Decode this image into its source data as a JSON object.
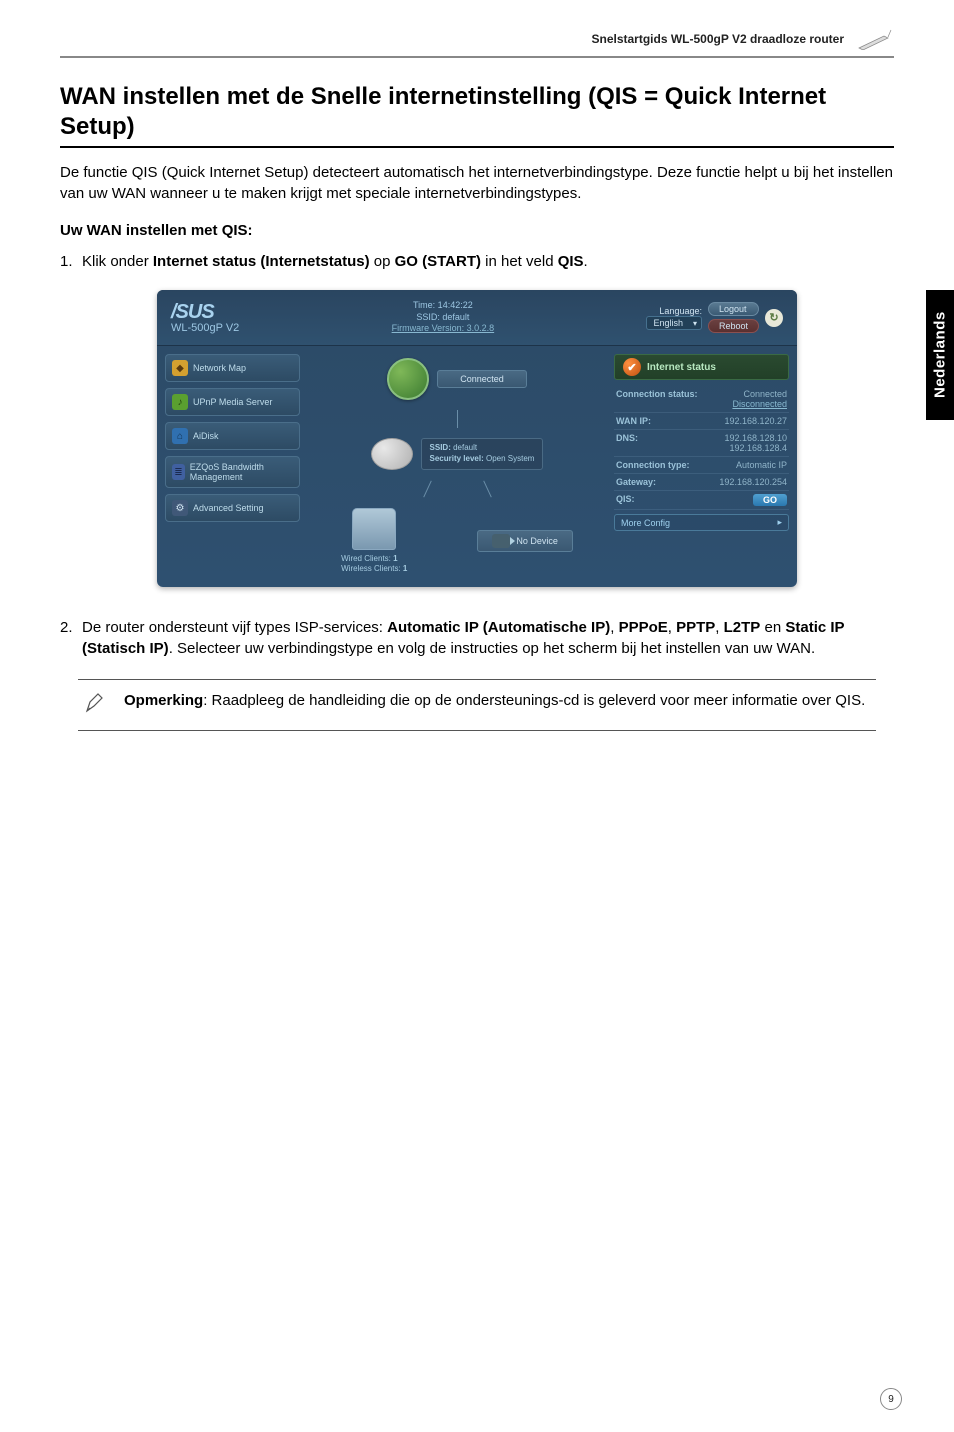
{
  "header": {
    "doc_title": "Snelstartgids WL-500gP V2 draadloze router"
  },
  "side_tab": "Nederlands",
  "section": {
    "title": "WAN instellen met de Snelle internetinstelling (QIS = Quick Internet Setup)",
    "intro": "De functie QIS (Quick Internet Setup) detecteert automatisch het internetverbindingstype. Deze functie helpt u bij het instellen van uw WAN wanneer u te maken krijgt met speciale internetverbindingstypes.",
    "subhead": "Uw WAN instellen met QIS:",
    "step1_pre": "Klik onder ",
    "step1_b1": "Internet status (Internetstatus)",
    "step1_mid": " op ",
    "step1_b2": "GO (START)",
    "step1_mid2": " in het veld ",
    "step1_b3": "QIS",
    "step1_end": ".",
    "step2_pre": "De router ondersteunt vijf types ISP-services: ",
    "step2_b1": "Automatic IP (Automatische IP)",
    "step2_c1": ", ",
    "step2_b2": "PPPoE",
    "step2_c2": ", ",
    "step2_b3": "PPTP",
    "step2_c3": ", ",
    "step2_b4": "L2TP",
    "step2_c4": " en ",
    "step2_b5": "Static IP (Statisch IP)",
    "step2_end": ". Selecteer uw verbindingstype en volg de instructies op het scherm bij het instellen van uw WAN."
  },
  "ui": {
    "brand": "/SUS",
    "model": "WL-500gP V2",
    "time_label": "Time: 14:42:22",
    "ssid_label": "SSID: default",
    "fw_label": "Firmware Version: 3.0.2.8",
    "lang_label": "Language:",
    "lang_value": "English",
    "btn_logout": "Logout",
    "btn_reboot": "Reboot",
    "btn_go": "GO",
    "nav": {
      "map": "Network Map",
      "ezqos": "UPnP Media Server",
      "aidisk": "AiDisk",
      "bw": "EZQoS Bandwidth Management",
      "adv": "Advanced Setting"
    },
    "center": {
      "connected": "Connected",
      "ssid_k": "SSID:",
      "ssid_v": "default",
      "sec_k": "Security level:",
      "sec_v": "Open System",
      "nodevice": "No Device",
      "wired_k": "Wired Clients:",
      "wired_v": "1",
      "wless_k": "Wireless Clients:",
      "wless_v": "1"
    },
    "right": {
      "header": "Internet status",
      "conn_k": "Connection status:",
      "conn_v": "Connected",
      "disc": "Disconnected",
      "wan_k": "WAN IP:",
      "wan_v": "192.168.120.27",
      "dns_k": "DNS:",
      "dns_v1": "192.168.128.10",
      "dns_v2": "192.168.128.4",
      "ctype_k": "Connection type:",
      "ctype_v": "Automatic IP",
      "gw_k": "Gateway:",
      "gw_v": "192.168.120.254",
      "qis_k": "QIS:",
      "qis_v": "GO",
      "more": "More Config"
    }
  },
  "note": {
    "label": "Opmerking",
    "text": ": Raadpleeg de handleiding die op de ondersteunings-cd is geleverd voor meer informatie over QIS."
  },
  "page_number": "9"
}
